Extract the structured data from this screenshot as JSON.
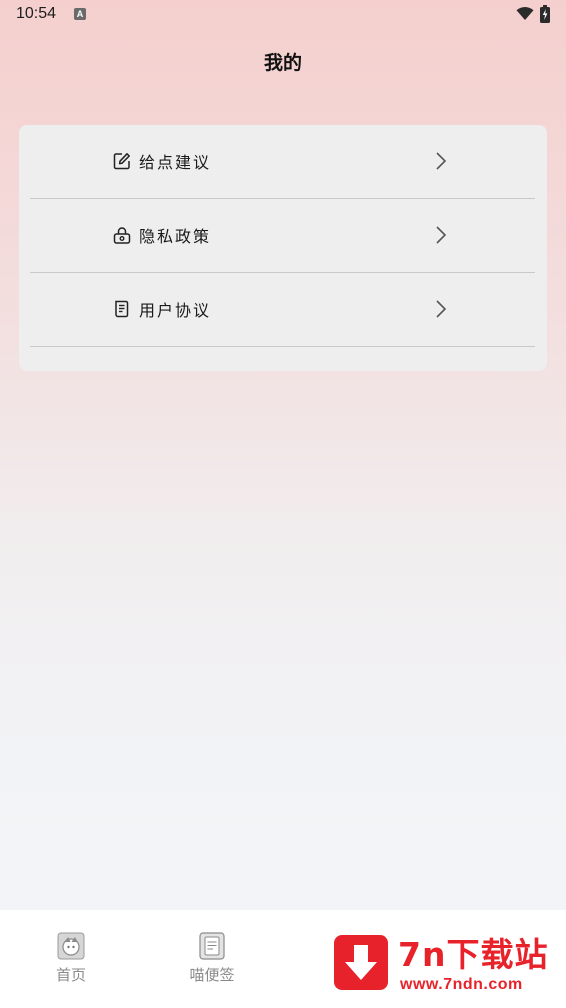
{
  "status_bar": {
    "time": "10:54",
    "badge": "A"
  },
  "header": {
    "title": "我的"
  },
  "menu": {
    "items": [
      {
        "label": "给点建议",
        "icon": "edit-icon"
      },
      {
        "label": "隐私政策",
        "icon": "lock-icon"
      },
      {
        "label": "用户协议",
        "icon": "document-icon"
      }
    ]
  },
  "bottom_nav": {
    "tabs": [
      {
        "label": "首页",
        "icon": "home-icon"
      },
      {
        "label": "喵便签",
        "icon": "notepad-icon"
      }
    ]
  },
  "watermark": {
    "brand": "7n下载站",
    "url": "www.7ndn.com"
  },
  "colors": {
    "accent": "#e8222a",
    "card": "#eeeeee",
    "divider": "#c9c9c9",
    "tab_inactive": "#8a8a8a"
  }
}
